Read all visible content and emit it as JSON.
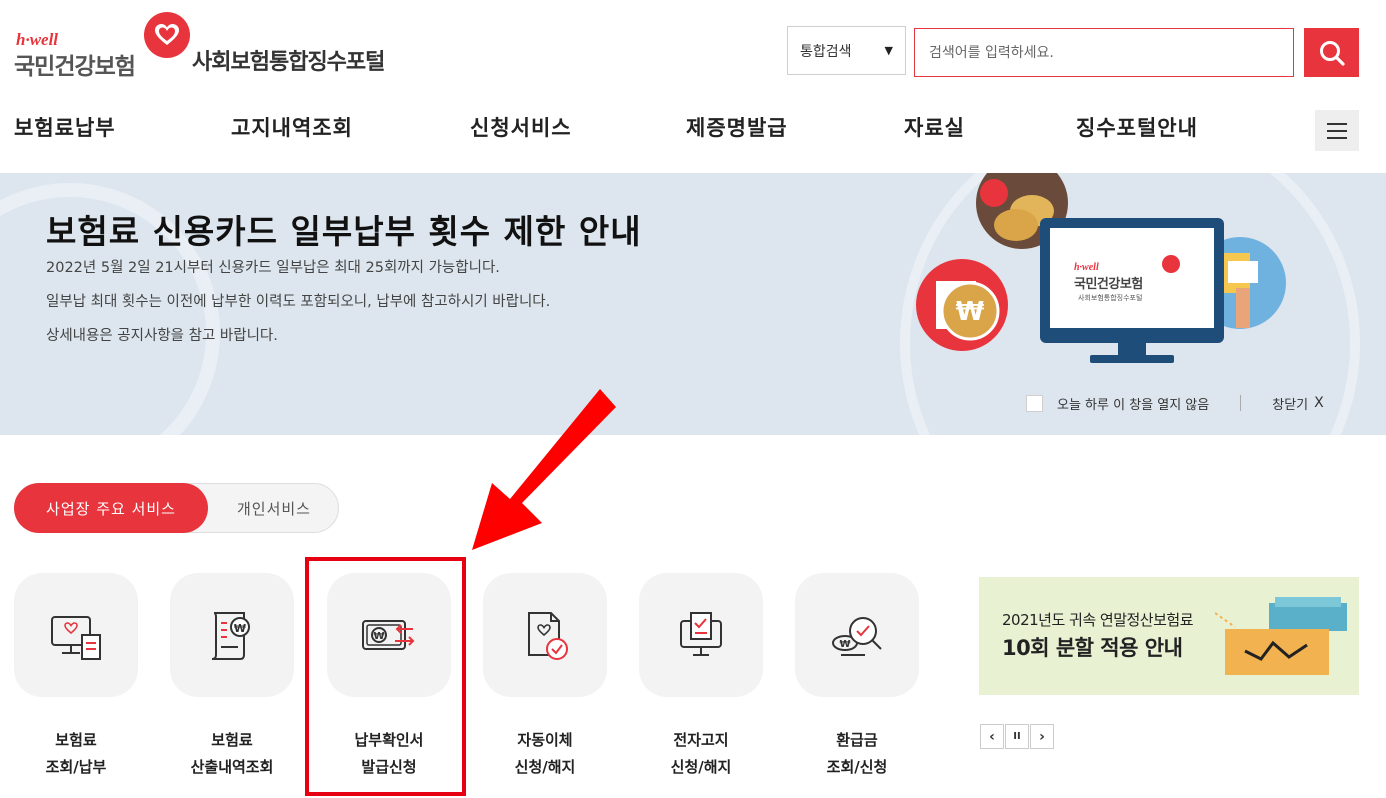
{
  "header": {
    "logo_tagline": "h·well",
    "logo_name": "국민건강보험",
    "portal_title": "사회보험통합징수포털",
    "search": {
      "scope_selected": "통합검색",
      "placeholder": "검색어를 입력하세요."
    }
  },
  "nav": {
    "items": [
      {
        "label": "보험료납부"
      },
      {
        "label": "고지내역조회"
      },
      {
        "label": "신청서비스"
      },
      {
        "label": "제증명발급"
      },
      {
        "label": "자료실"
      },
      {
        "label": "징수포털안내"
      }
    ]
  },
  "banner": {
    "title": "보험료 신용카드 일부납부 횟수 제한 안내",
    "lines": [
      "2022년 5월 2일 21시부터 신용카드 일부납은 최대 25회까지 가능합니다.",
      "일부납 최대 횟수는 이전에 납부한 이력도 포함되오니, 납부에 참고하시기 바랍니다.",
      "상세내용은 공지사항을 참고 바랍니다."
    ],
    "monitor_tagline": "h·well",
    "monitor_name": "국민건강보험",
    "monitor_sub": "사회보험통합징수포털",
    "dont_show_today": "오늘 하루 이 창을 열지 않음",
    "close_label": "창닫기",
    "close_x": "X"
  },
  "service_tabs": {
    "active": "사업장 주요 서비스",
    "other": "개인서비스"
  },
  "services": [
    {
      "line1": "보험료",
      "line2": "조회/납부",
      "icon": "monitor-heart-receipt-icon"
    },
    {
      "line1": "보험료",
      "line2": "산출내역조회",
      "icon": "document-won-icon"
    },
    {
      "line1": "납부확인서",
      "line2": "발급신청",
      "icon": "wallet-won-arrows-icon"
    },
    {
      "line1": "자동이체",
      "line2": "신청/해지",
      "icon": "document-check-icon"
    },
    {
      "line1": "전자고지",
      "line2": "신청/해지",
      "icon": "monitor-check-icon"
    },
    {
      "line1": "환급금",
      "line2": "조회/신청",
      "icon": "won-magnifier-check-icon"
    }
  ],
  "promo": {
    "line1": "2021년도 귀속 연말정산보험료",
    "line2": "10회 분할 적용 안내"
  },
  "pager": {
    "prev": "‹",
    "pause": "II",
    "next": "›"
  },
  "colors": {
    "accent": "#e8343d",
    "highlight": "#e60012",
    "banner_bg": "#dde6ee",
    "promo_bg": "#e8f2d3"
  }
}
